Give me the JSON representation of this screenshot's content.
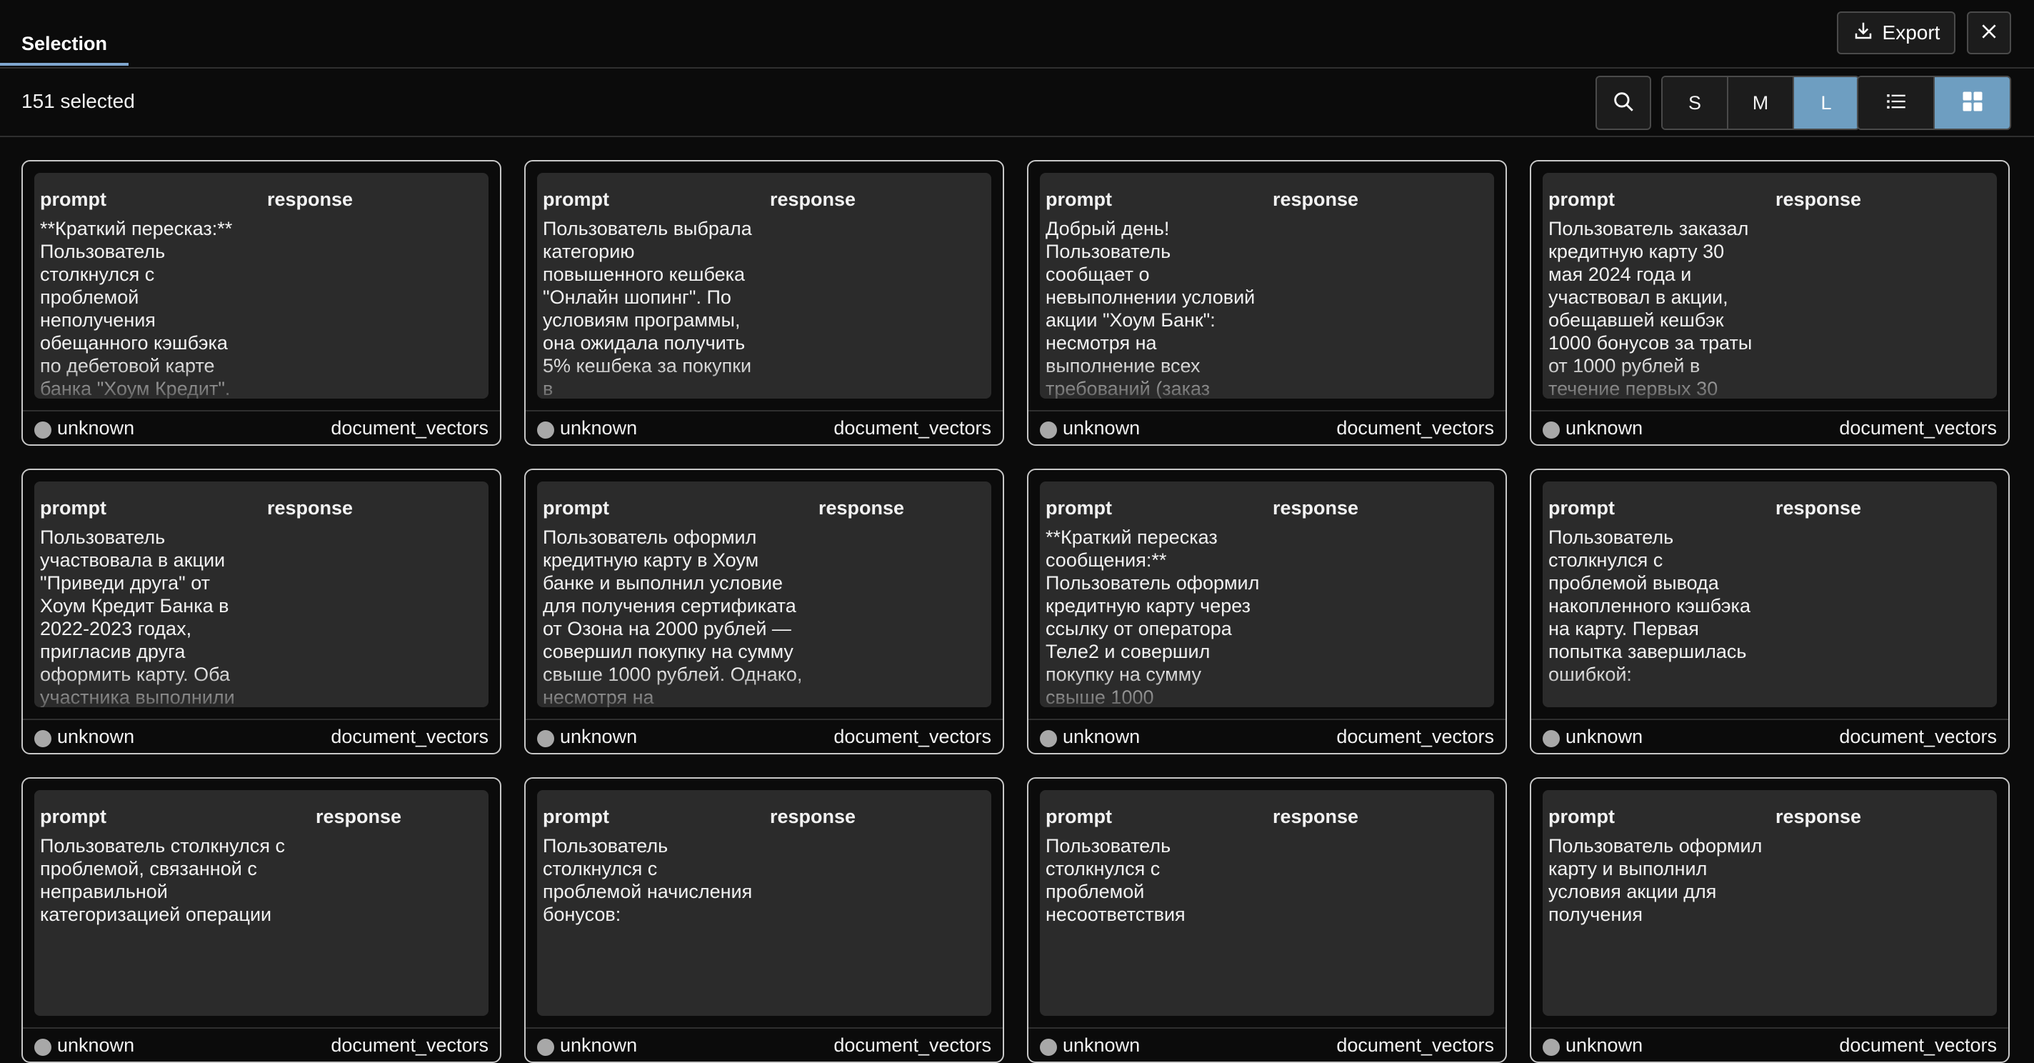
{
  "header": {
    "tab_label": "Selection",
    "export_label": "Export",
    "export_icon": "download-icon",
    "close_icon": "close-icon"
  },
  "toolbar": {
    "selected_count": "151 selected",
    "search_icon": "search-icon",
    "sizes": [
      "S",
      "M",
      "L"
    ],
    "active_size": "L",
    "views": [
      "list-view-icon",
      "grid-view-icon"
    ],
    "active_view": "grid-view-icon",
    "accent_color": "#6e9ec1"
  },
  "cards": [
    {
      "prompt_head": "prompt",
      "response_head": "response",
      "text": "**Краткий пересказ:** Пользователь столкнулся с проблемой неполучения обещанного кэшбэка по дебетовой карте банка \"Хоум Кредит\".",
      "status": "unknown",
      "source": "document_vectors"
    },
    {
      "prompt_head": "prompt",
      "response_head": "response",
      "text": "Пользователь выбрала категорию повышенного кешбека \"Онлайн шопинг\". По условиям программы, она ожидала получить 5% кешбека за покупки в",
      "status": "unknown",
      "source": "document_vectors"
    },
    {
      "prompt_head": "prompt",
      "response_head": "response",
      "text": "Добрый день! Пользователь сообщает о невыполнении условий акции \"Хоум Банк\": несмотря на выполнение всех требований (заказ",
      "status": "unknown",
      "source": "document_vectors"
    },
    {
      "prompt_head": "prompt",
      "response_head": "response",
      "text": "Пользователь заказал кредитную карту 30 мая 2024 года и участвовал в акции, обещавшей кешбэк 1000 бонусов за траты от 1000 рублей в течение первых 30",
      "status": "unknown",
      "source": "document_vectors"
    },
    {
      "prompt_head": "prompt",
      "response_head": "response",
      "text": "Пользователь участвовала в акции \"Приведи друга\" от Хоум Кредит Банка в 2022-2023 годах, пригласив друга оформить карту. Оба участника выполнили",
      "status": "unknown",
      "source": "document_vectors"
    },
    {
      "prompt_head": "prompt",
      "response_head": "response",
      "text": "Пользователь оформил кредитную карту в Хоум банке и выполнил условие для получения сертификата от Озона на 2000 рублей — совершил покупку на сумму свыше 1000 рублей. Однако, несмотря на",
      "status": "unknown",
      "source": "document_vectors",
      "wide": true
    },
    {
      "prompt_head": "prompt",
      "response_head": "response",
      "text": "**Краткий пересказ сообщения:** Пользователь оформил кредитную карту через ссылку от оператора Теле2 и совершил покупку на сумму свыше 1000",
      "status": "unknown",
      "source": "document_vectors"
    },
    {
      "prompt_head": "prompt",
      "response_head": "response",
      "text": "Пользователь столкнулся с проблемой вывода накопленного кэшбэка на карту. Первая попытка завершилась ошибкой:",
      "status": "unknown",
      "source": "document_vectors"
    },
    {
      "prompt_head": "prompt",
      "response_head": "response",
      "text": "Пользователь столкнулся с проблемой, связанной с неправильной категоризацией операции",
      "status": "unknown",
      "source": "document_vectors",
      "wide": true
    },
    {
      "prompt_head": "prompt",
      "response_head": "response",
      "text": "Пользователь столкнулся с проблемой начисления бонусов:",
      "status": "unknown",
      "source": "document_vectors"
    },
    {
      "prompt_head": "prompt",
      "response_head": "response",
      "text": "Пользователь столкнулся с проблемой несоответствия",
      "status": "unknown",
      "source": "document_vectors"
    },
    {
      "prompt_head": "prompt",
      "response_head": "response",
      "text": "Пользователь оформил карту и выполнил условия акции для получения",
      "status": "unknown",
      "source": "document_vectors"
    }
  ]
}
